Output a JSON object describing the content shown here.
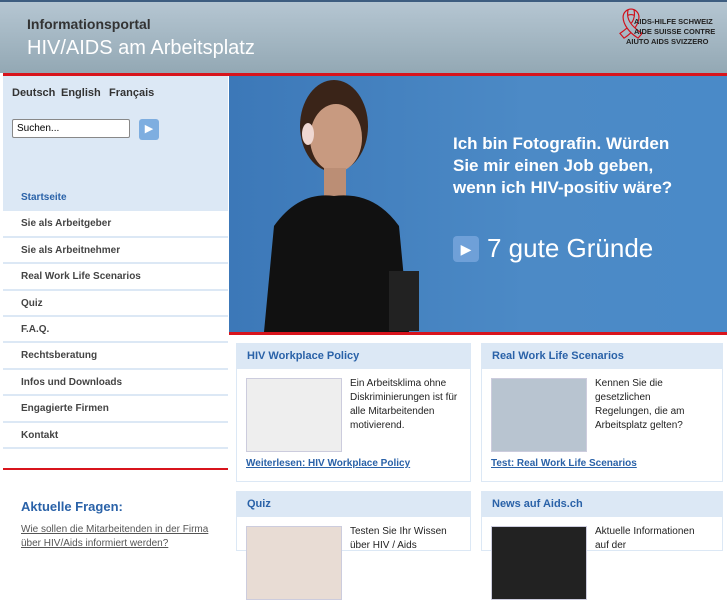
{
  "header": {
    "portal": "Informationsportal",
    "title": "HIV/AIDS am Arbeitsplatz",
    "logo_lines": [
      "AIDS-HILFE SCHWEIZ",
      "AIDE SUISSE CONTRE",
      "AIUTO AIDS SVIZZERO"
    ]
  },
  "languages": [
    "Deutsch",
    "English",
    "Français"
  ],
  "search": {
    "value": "Suchen..."
  },
  "nav": [
    "Startseite",
    "Sie als Arbeitgeber",
    "Sie als Arbeitnehmer",
    "Real Work Life Scenarios",
    "Quiz",
    "F.A.Q.",
    "Rechtsberatung",
    "Infos und Downloads",
    "Engagierte Firmen",
    "Kontakt"
  ],
  "aside": {
    "title": "Aktuelle Fragen:",
    "link": "Wie sollen die Mitarbeitenden in der Firma über HIV/Aids informiert werden?"
  },
  "hero": {
    "quote": [
      "Ich bin Fotografin. Würden",
      "Sie mir einen Job geben,",
      "wenn ich HIV-positiv wäre?"
    ],
    "cta": "7 gute Gründe"
  },
  "cards": [
    {
      "title": "HIV Workplace Policy",
      "text": "Ein Arbeitsklima ohne Diskriminierungen ist für alle Mitarbeitenden motivierend.",
      "link": "Weiterlesen: HIV Workplace Policy"
    },
    {
      "title": "Real Work Life Scenarios",
      "text": "Kennen Sie die gesetzlichen Regelungen, die am Arbeitsplatz gelten?",
      "link": "Test: Real Work Life Scenarios"
    },
    {
      "title": "Quiz",
      "text": "Testen Sie Ihr Wissen über HIV / Aids"
    },
    {
      "title": "News auf Aids.ch",
      "text": "Aktuelle Informationen auf der"
    }
  ]
}
